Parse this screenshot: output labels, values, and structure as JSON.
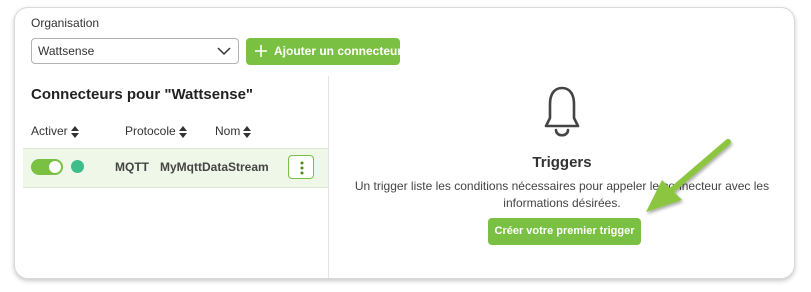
{
  "organisation": {
    "label": "Organisation",
    "selected": "Wattsense",
    "add_connector_label": "Ajouter un connecteur"
  },
  "connectors": {
    "title": "Connecteurs pour \"Wattsense\"",
    "columns": [
      "Activer",
      "Protocole",
      "Nom"
    ],
    "rows": [
      {
        "enabled": true,
        "status": "active",
        "protocol": "MQTT",
        "name": "MyMqttDataStream"
      }
    ]
  },
  "triggers": {
    "icon": "bell-icon",
    "title": "Triggers",
    "description": "Un trigger liste les conditions nécessaires pour appeler le connecteur avec les informations désirées.",
    "create_label": "Créer votre premier trigger"
  },
  "colors": {
    "accent": "#7ac143",
    "status_active": "#3ebc8a",
    "annotation_arrow": "#8cc63f",
    "selected_row": "#eef7e8"
  }
}
